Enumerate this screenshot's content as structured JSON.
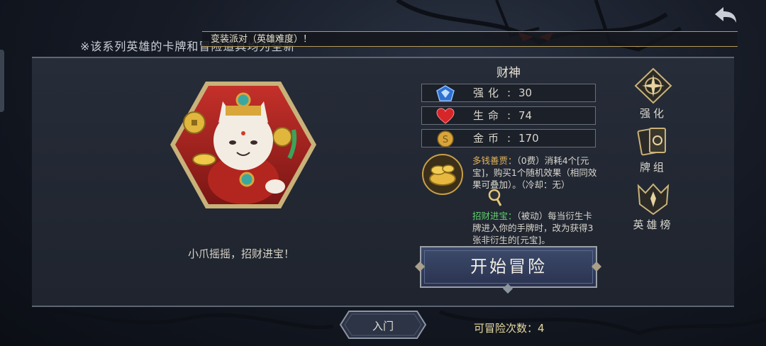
{
  "notice": "※该系列英雄的卡牌和冒险道具均为全新",
  "ticker": "变装派对（英雄难度）！",
  "hero": {
    "name": "财神",
    "tagline": "小爪摇摇，招财进宝！"
  },
  "stats": [
    {
      "icon": "blue-shield-icon",
      "label": "强化",
      "value": "30"
    },
    {
      "icon": "red-heart-icon",
      "label": "生命",
      "value": "74"
    },
    {
      "icon": "gold-coin-icon",
      "label": "金币",
      "value": "170"
    }
  ],
  "skills": {
    "skill1_title": "多钱善贾：",
    "skill1_body": "（0费）消耗4个[元宝]，购买1个随机效果（相同效果可叠加）。（冷却：无）",
    "skill2_title": "招财进宝：",
    "skill2_body": "（被动）每当衍生卡牌进入你的手牌时，改为获得3张非衍生的[元宝]。"
  },
  "start_button": "开始冒险",
  "side_menu": [
    {
      "icon": "upgrade-compass-icon",
      "label": "强化"
    },
    {
      "icon": "card-deck-icon",
      "label": "牌组"
    },
    {
      "icon": "hero-ranking-icon",
      "label": "英雄榜"
    }
  ],
  "entry_button": "入门",
  "adventure_count_label": "可冒险次数：",
  "adventure_count_value": "4",
  "colors": {
    "panel_bg": "#262c38",
    "button_blue": "#3d4a6b",
    "gold_accent": "#e3b45a",
    "green_accent": "#5fd16c"
  }
}
